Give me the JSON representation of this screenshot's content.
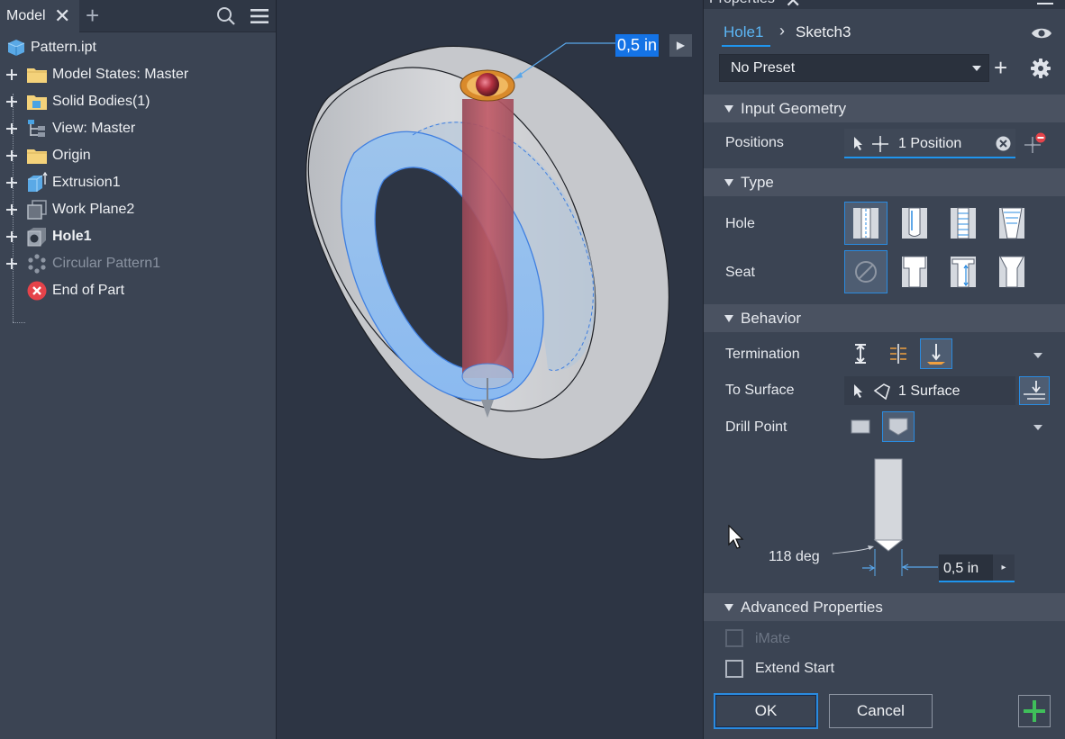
{
  "browser": {
    "tab_label": "Model",
    "close_glyph": "✕",
    "add_glyph": "+",
    "tree": [
      {
        "label": "Pattern.ipt",
        "icon": "part-icon",
        "bold": false,
        "dim": false
      },
      {
        "label": "Model States: Master",
        "icon": "folder-icon",
        "bold": false,
        "dim": false
      },
      {
        "label": "Solid Bodies(1)",
        "icon": "solid-bodies-icon",
        "bold": false,
        "dim": false
      },
      {
        "label": "View: Master",
        "icon": "view-icon",
        "bold": false,
        "dim": false
      },
      {
        "label": "Origin",
        "icon": "folder-icon",
        "bold": false,
        "dim": false
      },
      {
        "label": "Extrusion1",
        "icon": "extrusion-icon",
        "bold": false,
        "dim": false
      },
      {
        "label": "Work Plane2",
        "icon": "work-plane-icon",
        "bold": false,
        "dim": false
      },
      {
        "label": "Hole1",
        "icon": "hole-icon",
        "bold": true,
        "dim": false
      },
      {
        "label": "Circular Pattern1",
        "icon": "circular-pattern-icon",
        "bold": false,
        "dim": true
      },
      {
        "label": "End of Part",
        "icon": "end-of-part-icon",
        "bold": false,
        "dim": false
      }
    ]
  },
  "viewport": {
    "dimension_value": "0,5 in",
    "dimension_arrow": "▶"
  },
  "properties": {
    "title": "Properties",
    "close_glyph": "✕",
    "breadcrumb": {
      "hole": "Hole1",
      "sep": "›",
      "sketch": "Sketch3"
    },
    "preset": {
      "value": "No Preset"
    },
    "preset_add_glyph": "+",
    "sections": {
      "input_geometry": "Input Geometry",
      "type": "Type",
      "behavior": "Behavior",
      "advanced": "Advanced Properties"
    },
    "positions": {
      "label": "Positions",
      "value": "1 Position"
    },
    "hole_label": "Hole",
    "seat_label": "Seat",
    "termination": {
      "label": "Termination"
    },
    "to_surface": {
      "label": "To Surface",
      "value": "1 Surface"
    },
    "drill_point": {
      "label": "Drill Point",
      "angle": "118 deg",
      "diameter": "0,5 in",
      "diameter_arrow": "▸"
    },
    "imate": {
      "label": "iMate",
      "checked": false,
      "enabled": false
    },
    "extend_start": {
      "label": "Extend Start",
      "checked": false,
      "enabled": true
    },
    "ok_label": "OK",
    "cancel_label": "Cancel"
  },
  "colors": {
    "accent": "#1f95ee",
    "panel": "#3b4453",
    "viewport": "#2d3544",
    "hole_red": "#b33a44",
    "add_green": "#3fbf5a"
  }
}
